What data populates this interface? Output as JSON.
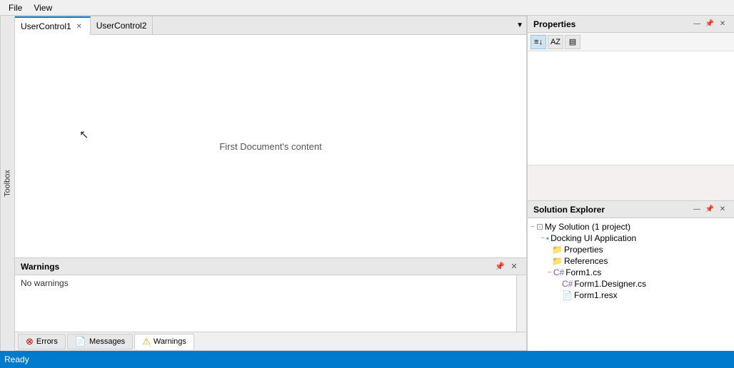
{
  "menubar": {
    "items": [
      "File",
      "View"
    ]
  },
  "toolbox": {
    "label": "Toolbox"
  },
  "document": {
    "tabs": [
      {
        "id": "tab1",
        "label": "UserControl1",
        "active": true,
        "closable": true
      },
      {
        "id": "tab2",
        "label": "UserControl2",
        "active": false,
        "closable": false
      }
    ],
    "content": "First Document's content"
  },
  "warnings_panel": {
    "title": "Warnings",
    "no_warnings": "No warnings",
    "tabs": [
      {
        "id": "errors",
        "label": "Errors",
        "icon": "error"
      },
      {
        "id": "messages",
        "label": "Messages",
        "icon": "messages"
      },
      {
        "id": "warnings",
        "label": "Warnings",
        "icon": "warnings",
        "active": true
      }
    ]
  },
  "properties_panel": {
    "title": "Properties",
    "toolbar_buttons": [
      "categorized",
      "alphabetical",
      "properties"
    ],
    "close_label": "✕",
    "pin_label": "📌",
    "minimize_label": "—"
  },
  "solution_explorer": {
    "title": "Solution Explorer",
    "close_label": "✕",
    "pin_label": "📌",
    "minimize_label": "—",
    "tree": [
      {
        "id": "solution",
        "indent": 0,
        "expand": "−",
        "icon": "sol",
        "label": "My Solution (1 project)"
      },
      {
        "id": "project",
        "indent": 1,
        "expand": "−",
        "icon": "proj",
        "label": "Docking UI Application"
      },
      {
        "id": "properties",
        "indent": 2,
        "expand": "",
        "icon": "folder",
        "label": "Properties"
      },
      {
        "id": "references",
        "indent": 2,
        "expand": "",
        "icon": "folder",
        "label": "References"
      },
      {
        "id": "form1",
        "indent": 2,
        "expand": "−",
        "icon": "cs",
        "label": "Form1.cs"
      },
      {
        "id": "form1designer",
        "indent": 3,
        "expand": "",
        "icon": "cs",
        "label": "Form1.Designer.cs"
      },
      {
        "id": "form1resx",
        "indent": 3,
        "expand": "",
        "icon": "resx",
        "label": "Form1.resx"
      }
    ]
  },
  "status_bar": {
    "text": "Ready"
  }
}
